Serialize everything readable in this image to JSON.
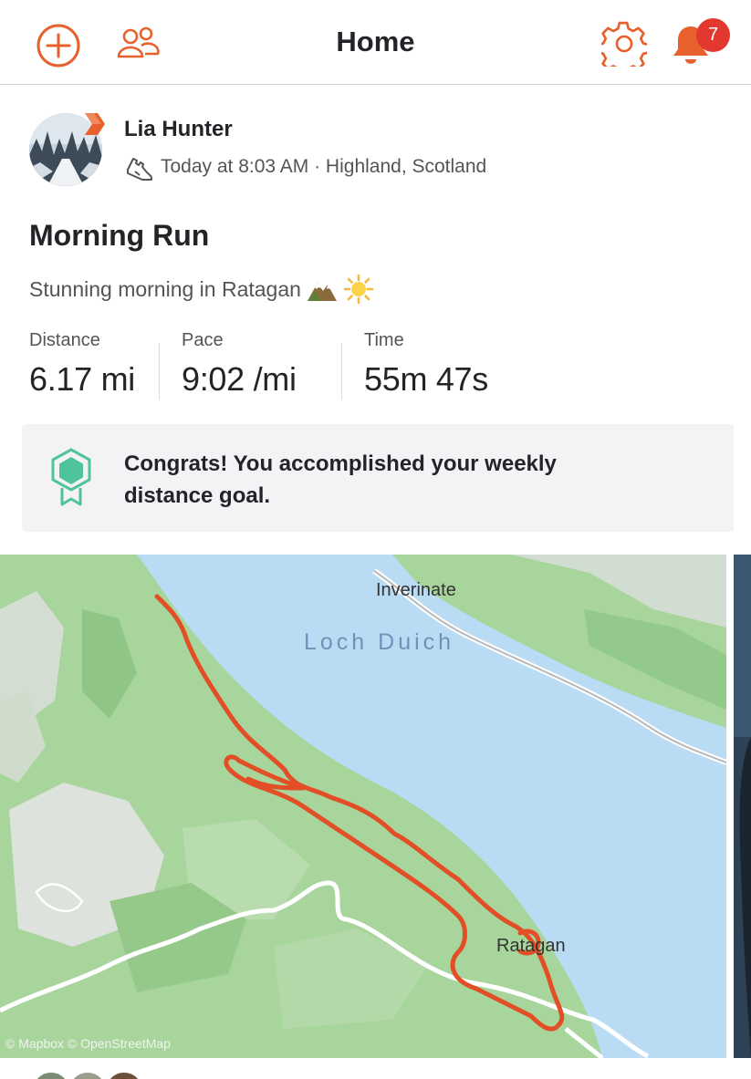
{
  "header": {
    "title": "Home",
    "notification_count": "7",
    "icons": [
      "add-circle-icon",
      "people-icon",
      "gear-icon",
      "bell-icon"
    ]
  },
  "activity": {
    "athlete_name": "Lia Hunter",
    "meta": "Today at 8:03 AM · Highland, Scotland",
    "title": "Morning Run",
    "description": "Stunning morning in Ratagan",
    "stats": [
      {
        "label": "Distance",
        "value": "6.17 mi"
      },
      {
        "label": "Pace",
        "value": "9:02 /mi"
      },
      {
        "label": "Time",
        "value": "55m 47s"
      }
    ],
    "achievement": "Congrats! You accomplished your weekly distance goal."
  },
  "map": {
    "labels": {
      "town_top": "Inverinate",
      "loch": "Loch Duich",
      "town_bottom": "Ratagan"
    },
    "attribution": "© Mapbox © OpenStreetMap"
  },
  "colors": {
    "brand": "#e8602b",
    "route": "#e24e26",
    "badge": "#e2382f",
    "water": "#b9dcf4",
    "land": "#a8d59c",
    "medal": "#4fc39a"
  }
}
